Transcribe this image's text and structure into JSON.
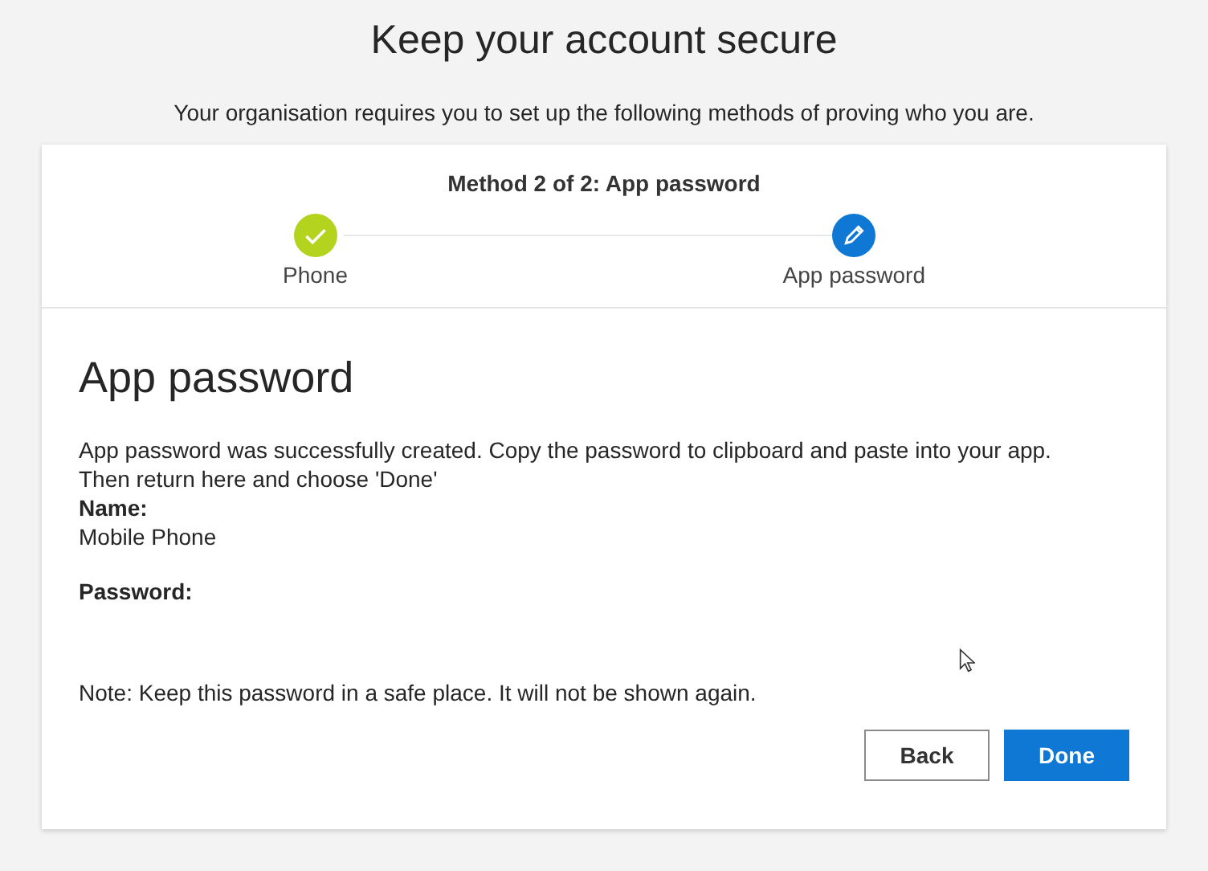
{
  "title": "Keep your account secure",
  "subtitle": "Your organisation requires you to set up the following methods of proving who you are.",
  "progress": {
    "heading": "Method 2 of 2: App password",
    "steps": [
      {
        "label": "Phone",
        "kind": "done"
      },
      {
        "label": "App password",
        "kind": "current"
      }
    ]
  },
  "section": {
    "heading": "App password",
    "message": "App password was successfully created. Copy the password to clipboard and paste into your app. Then return here and choose 'Done'",
    "name_label": "Name:",
    "name_value": "Mobile Phone",
    "password_label": "Password:",
    "note": "Note: Keep this password in a safe place. It will not be shown again."
  },
  "buttons": [
    {
      "label": "Back",
      "kind": "secondary"
    },
    {
      "label": "Done",
      "kind": "primary"
    }
  ]
}
